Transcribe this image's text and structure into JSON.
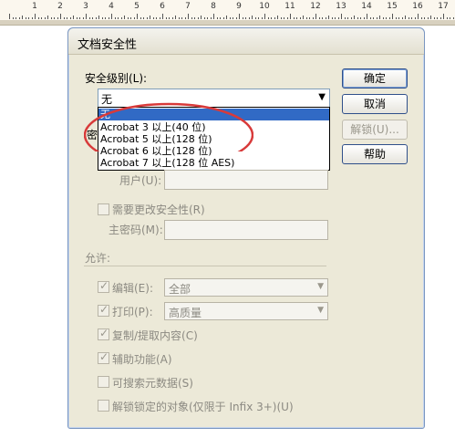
{
  "ruler": {
    "numbers": [
      "1",
      "2",
      "3",
      "4",
      "5",
      "6",
      "7",
      "8",
      "9",
      "10",
      "11",
      "12",
      "13",
      "14",
      "15",
      "16",
      "17"
    ]
  },
  "dialog": {
    "title": "文档安全性",
    "security_level_label": "安全级别(L):",
    "security_level_value": "无",
    "options": [
      "无",
      "Acrobat 3 以上(40 位)",
      "Acrobat 5 以上(128 位)",
      "Acrobat 6 以上(128 位)",
      "Acrobat 7 以上(128 位 AES)"
    ],
    "password_label_fragment": "密",
    "user_label": "用户(U):",
    "need_change_security": "需要更改安全性(R)",
    "master_password": "主密码(M):",
    "allow_label": "允许:",
    "edit_label": "编辑(E):",
    "edit_value": "全部",
    "print_label": "打印(P):",
    "print_value": "高质量",
    "copy_extract": "复制/提取内容(C)",
    "accessibility": "辅助功能(A)",
    "searchable_metadata": "可搜索元数据(S)",
    "unlock_objects": "解锁锁定的对象(仅限于 Infix 3+)(U)",
    "buttons": {
      "ok": "确定",
      "cancel": "取消",
      "unlock": "解锁(U)...",
      "help": "帮助"
    }
  }
}
